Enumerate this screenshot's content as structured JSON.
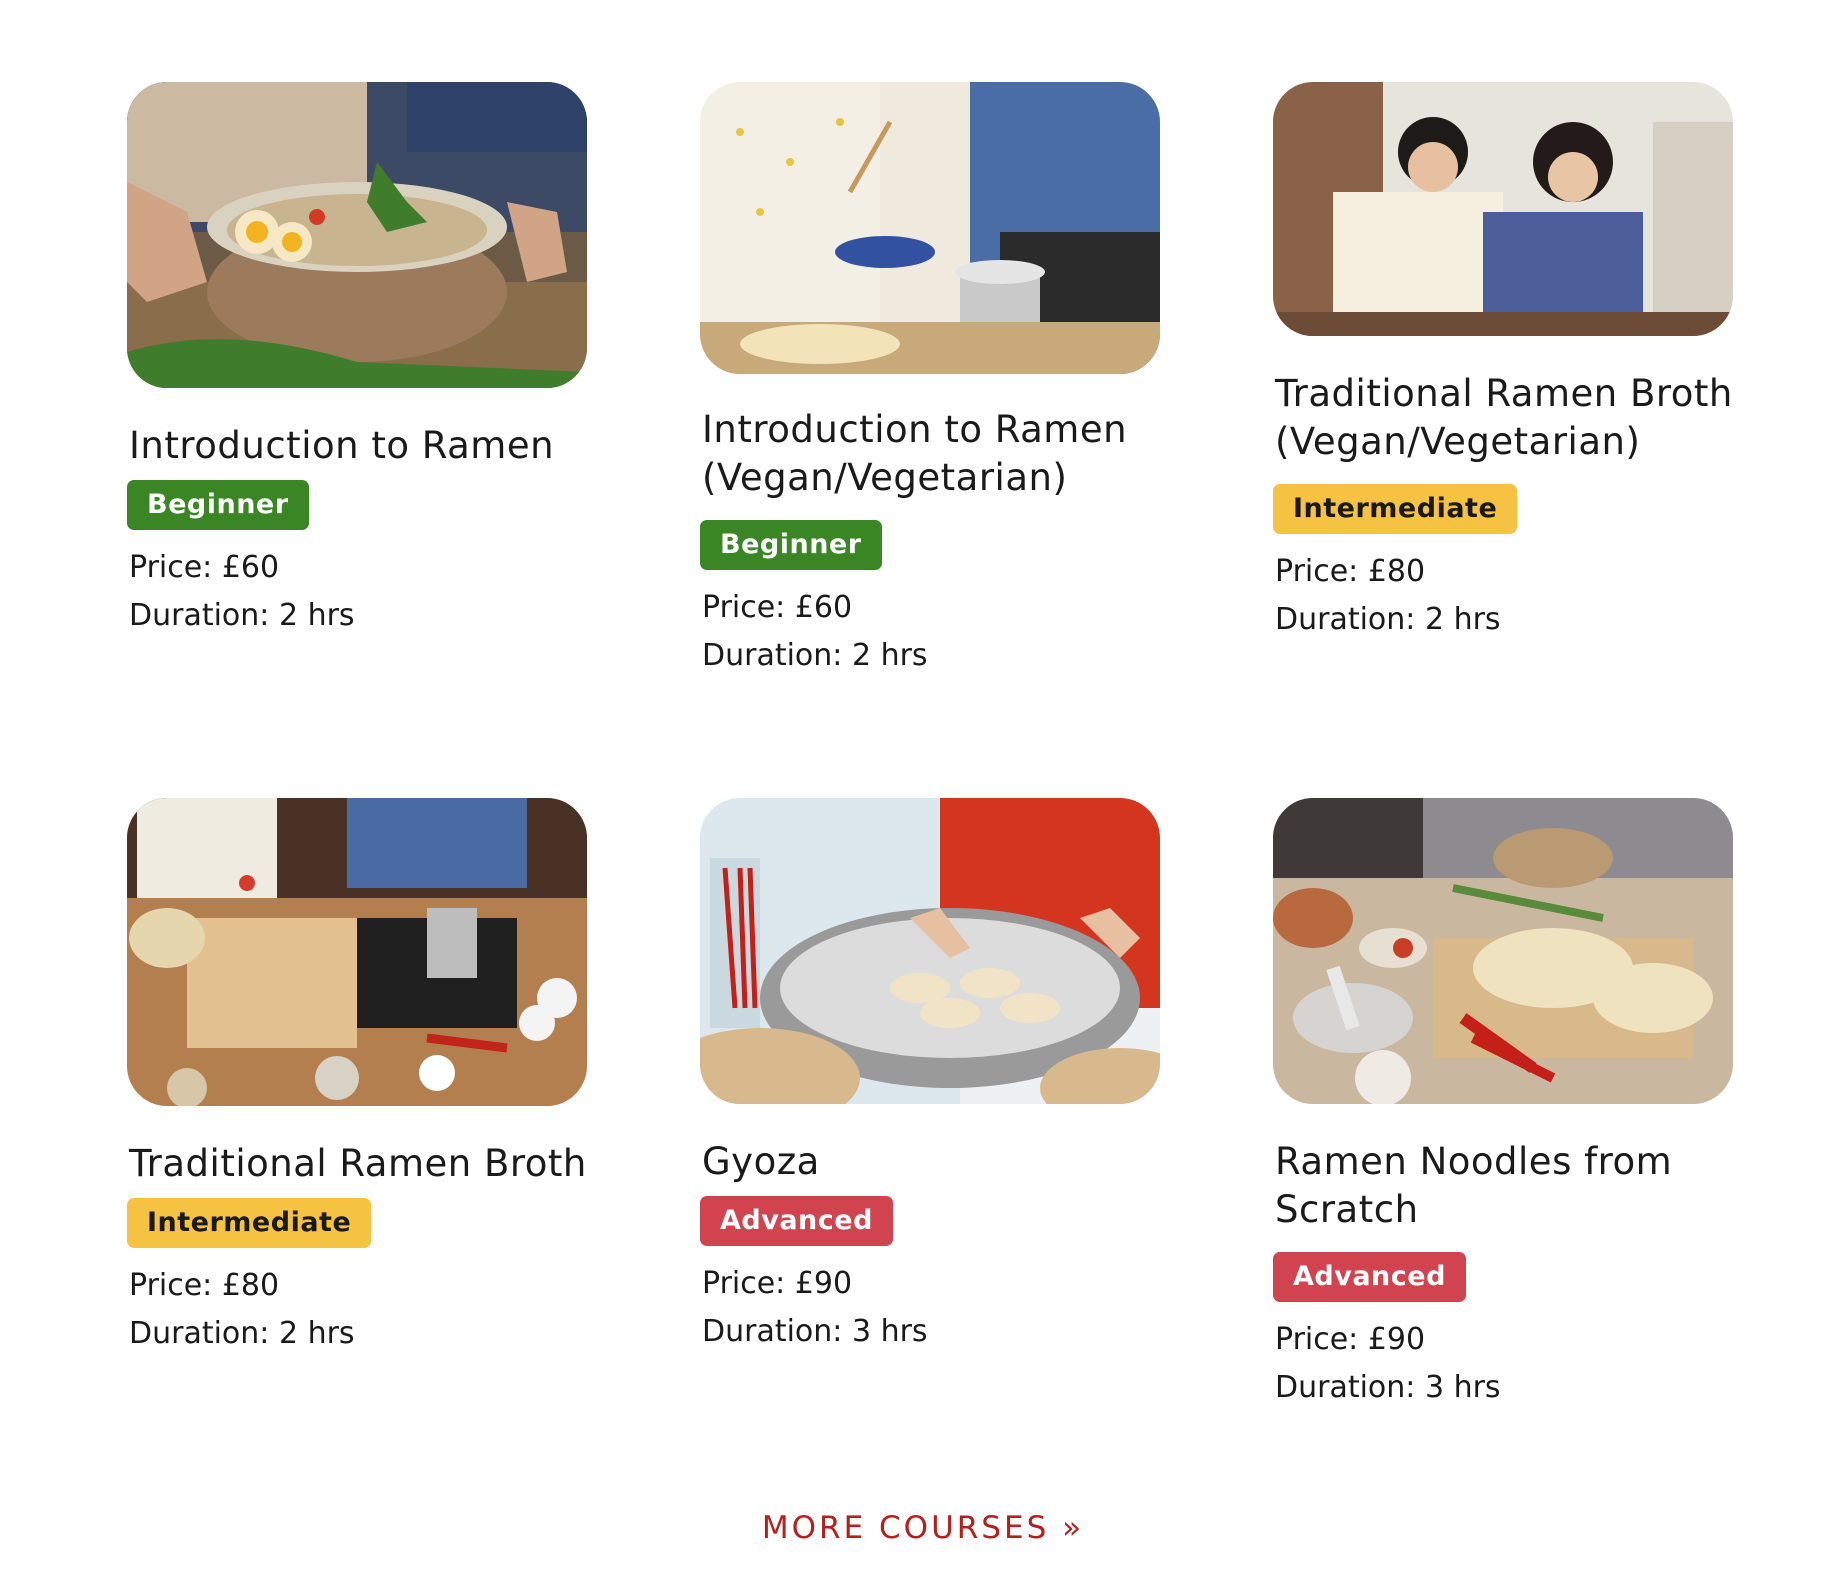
{
  "courses": [
    {
      "title": "Introduction to Ramen",
      "level": "Beginner",
      "price": "Price: £60",
      "duration": "Duration: 2 hrs",
      "image": "ramen-bowl-photo"
    },
    {
      "title": "Introduction to Ramen (Vegan/Vegetarian)",
      "level": "Beginner",
      "price": "Price: £60",
      "duration": "Duration: 2 hrs",
      "image": "cooking-pot-photo"
    },
    {
      "title": "Traditional Ramen Broth (Vegan/Vegetarian)",
      "level": "Intermediate",
      "price": "Price: £80",
      "duration": "Duration: 2 hrs",
      "image": "two-women-cooking-photo"
    },
    {
      "title": "Traditional Ramen Broth",
      "level": "Intermediate",
      "price": "Price: £80",
      "duration": "Duration: 2 hrs",
      "image": "kitchen-counter-photo"
    },
    {
      "title": "Gyoza",
      "level": "Advanced",
      "price": "Price: £90",
      "duration": "Duration: 3 hrs",
      "image": "gyoza-steamer-photo"
    },
    {
      "title": "Ramen Noodles from Scratch",
      "level": "Advanced",
      "price": "Price: £90",
      "duration": "Duration: 3 hrs",
      "image": "noodles-table-photo"
    }
  ],
  "more_link": "MORE COURSES »",
  "colors": {
    "beginner": "#3a8524",
    "intermediate": "#f5c242",
    "advanced": "#d0434f",
    "link": "#b5201e"
  }
}
